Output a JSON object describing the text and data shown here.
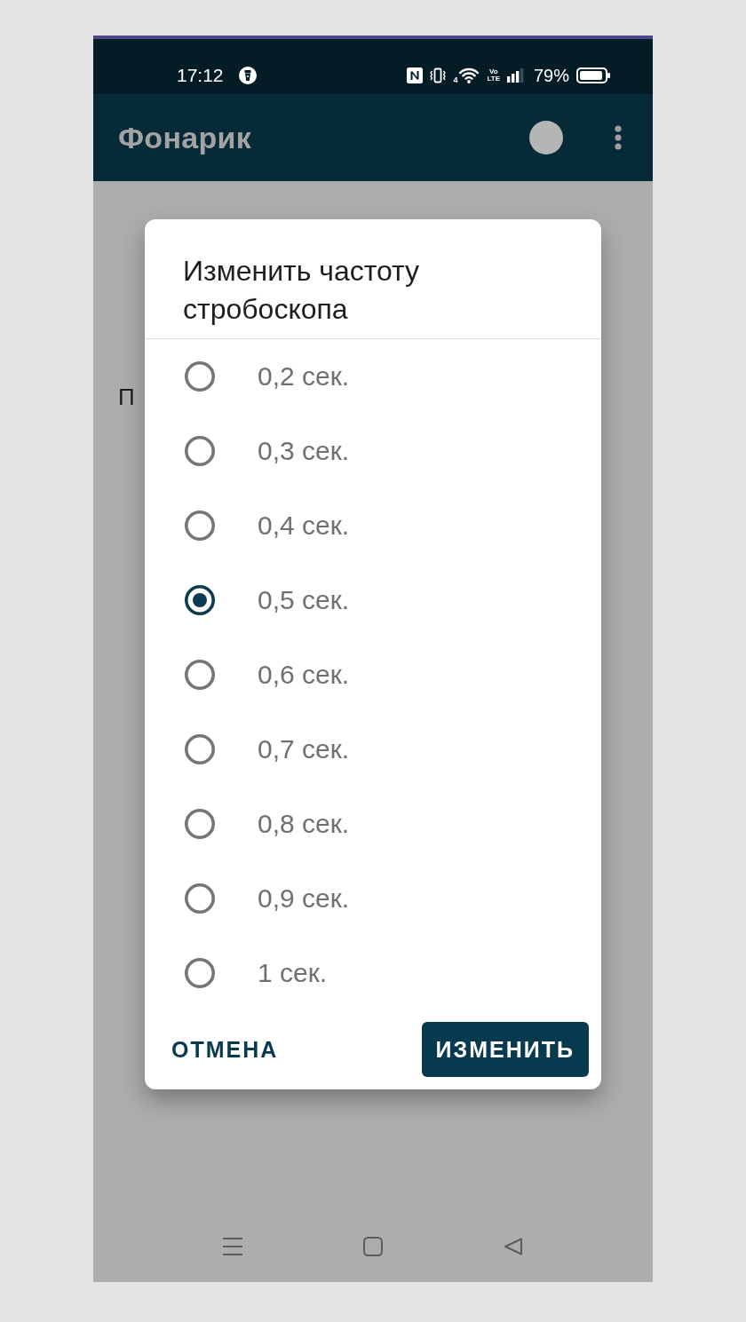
{
  "status_bar": {
    "time": "17:12",
    "network_type": "4",
    "volte": "Vo LTE",
    "battery": "79%"
  },
  "app_bar": {
    "title": "Фонарик"
  },
  "background": {
    "label": "П"
  },
  "dialog": {
    "title": "Изменить частоту стробоскопа",
    "options": [
      {
        "label": "0,2 сек.",
        "selected": false
      },
      {
        "label": "0,3 сек.",
        "selected": false
      },
      {
        "label": "0,4 сек.",
        "selected": false
      },
      {
        "label": "0,5 сек.",
        "selected": true
      },
      {
        "label": "0,6 сек.",
        "selected": false
      },
      {
        "label": "0,7 сек.",
        "selected": false
      },
      {
        "label": "0,8 сек.",
        "selected": false
      },
      {
        "label": "0,9 сек.",
        "selected": false
      },
      {
        "label": "1 сек.",
        "selected": false
      }
    ],
    "buttons": [
      {
        "label": "ОТМЕНА",
        "kind": "text"
      },
      {
        "label": "ИЗМЕНИТЬ",
        "kind": "filled"
      }
    ]
  }
}
